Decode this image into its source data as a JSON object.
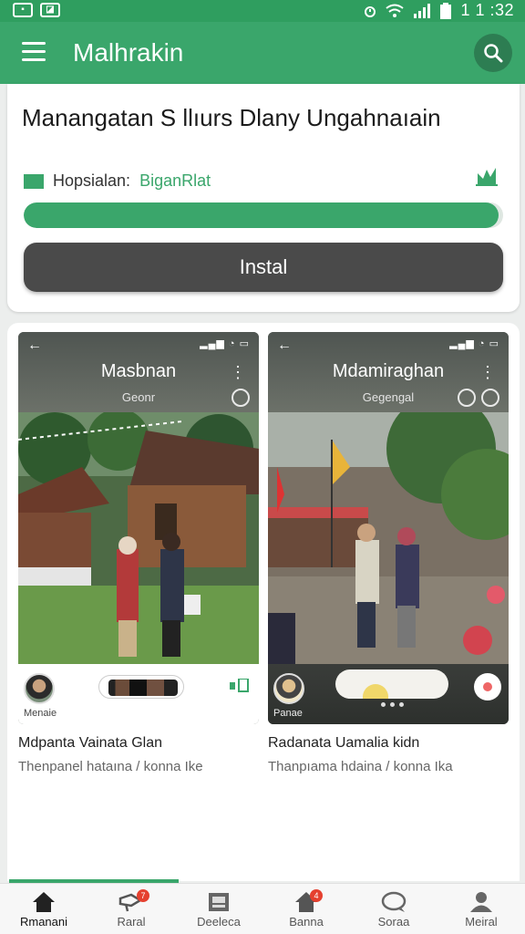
{
  "status_bar": {
    "time": "1 ‭1 ‬:32",
    "left_icons": [
      "notification-box-icon",
      "gallery-icon"
    ],
    "right_icons": [
      "alarm-icon",
      "wifi-icon",
      "signal-icon",
      "battery-icon"
    ]
  },
  "app_bar": {
    "title": "Malhrakin"
  },
  "install_card": {
    "headline": "Manangatan S llıurs Dlany Ungahnaıain",
    "progress_label": "Hopsialan:",
    "progress_value": "BiganRlat",
    "progress_fraction": 0.99,
    "install_button": "Instal"
  },
  "feed": {
    "cards": [
      {
        "screen_title": "Masbnan",
        "screen_subtitle": "Geonr",
        "footer_name": "Menaie",
        "title": "Mdpanta Vainata Glan",
        "subtitle": "Thenpanel hataına / konna Ike"
      },
      {
        "screen_title": "Mdamiraghan",
        "screen_subtitle": "Gegengal",
        "footer_name": "Panae",
        "title": "Radanata Uamalia kidn",
        "subtitle": "Thanpıama hdaina / konna Ika"
      }
    ]
  },
  "bottom_nav": {
    "items": [
      {
        "label": "Rmanani",
        "icon": "home-icon",
        "badge": ""
      },
      {
        "label": "Raral",
        "icon": "megaphone-icon",
        "badge": "7"
      },
      {
        "label": "Deeleca",
        "icon": "image-icon",
        "badge": ""
      },
      {
        "label": "Banna",
        "icon": "house-icon",
        "badge": "4"
      },
      {
        "label": "Soraa",
        "icon": "chat-icon",
        "badge": ""
      },
      {
        "label": "Meiral",
        "icon": "profile-icon",
        "badge": ""
      }
    ]
  },
  "colors": {
    "primary_green": "#3aa66b",
    "dark_green": "#2f9e5f",
    "button_dark": "#4a4a4a",
    "badge_red": "#e5402f"
  }
}
